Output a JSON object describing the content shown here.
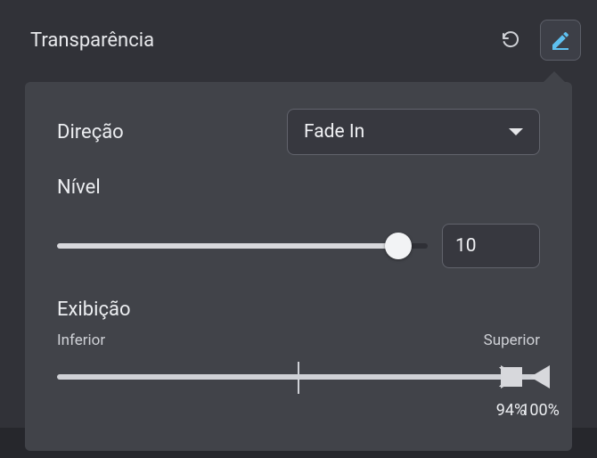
{
  "header": {
    "title": "Transparência"
  },
  "icons": {
    "reset": "reset-icon",
    "edit": "pencil-icon"
  },
  "direction": {
    "label": "Direção",
    "value": "Fade In"
  },
  "level": {
    "label": "Nível",
    "value": "10",
    "percent": 92
  },
  "range": {
    "label": "Exibição",
    "min_label": "Inferior",
    "max_label": "Superior",
    "lower_percent": 94,
    "upper_percent": 100,
    "lower_text": "94%",
    "upper_text": "100%"
  }
}
